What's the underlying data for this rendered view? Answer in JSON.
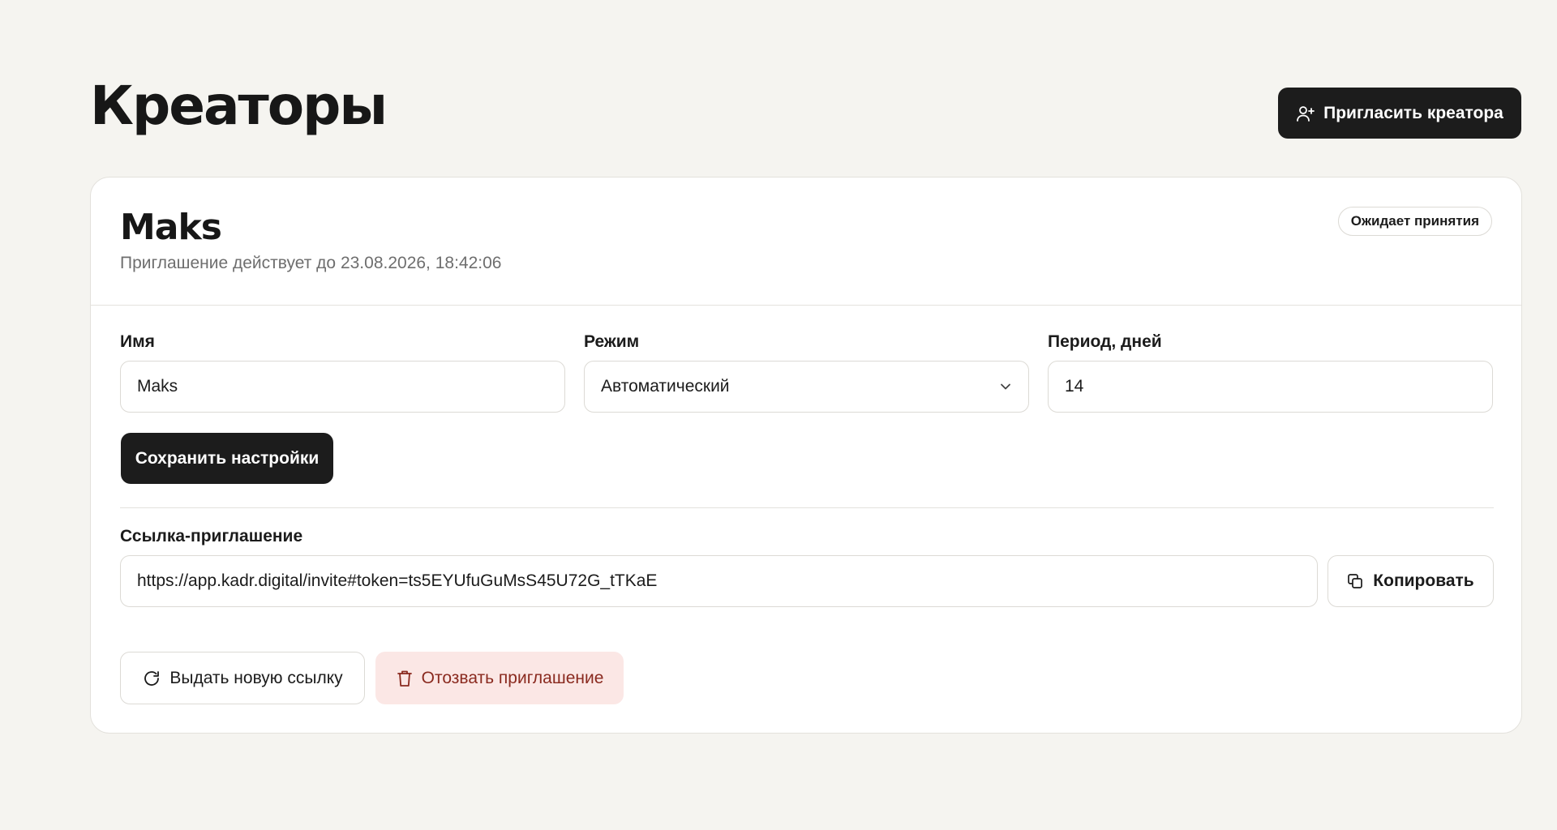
{
  "page": {
    "title": "Креаторы",
    "invite_button_label": "Пригласить креатора",
    "invite_button_icon": "user-plus-icon"
  },
  "creator": {
    "name": "Maks",
    "expiry_text": "Приглашение действует до 23.08.2026, 18:42:06",
    "status_badge": "Ожидает принятия"
  },
  "form": {
    "name_label": "Имя",
    "name_value": "Maks",
    "mode_label": "Режим",
    "mode_value": "Автоматический",
    "period_label": "Период, дней",
    "period_value": "14",
    "save_label": "Сохранить настройки"
  },
  "invite_link": {
    "label": "Ссылка-приглашение",
    "url": "https://app.kadr.digital/invite#token=ts5EYUfuGuMsS45U72G_tTKaE",
    "copy_label": "Копировать",
    "copy_icon": "copy-icon"
  },
  "actions": {
    "new_link_label": "Выдать новую ссылку",
    "new_link_icon": "refresh-icon",
    "revoke_label": "Отозвать приглашение",
    "revoke_icon": "trash-icon"
  },
  "colors": {
    "background": "#f5f4f0",
    "primary_button": "#1c1c1c",
    "danger_bg": "#fbe7e5",
    "danger_text": "#8a2a1f"
  }
}
